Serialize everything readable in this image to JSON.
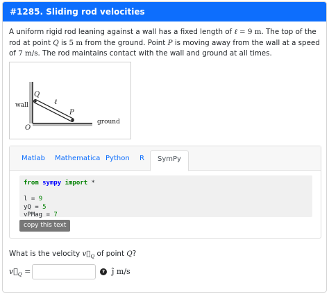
{
  "header": {
    "title": "#1285. Sliding rod velocities"
  },
  "problem": {
    "t1": "A uniform rigid rod leaning against a wall has a fixed length of ",
    "ell": "ℓ",
    "eq1": " = 9 m",
    "t2": ". The top of the rod at point ",
    "Q": "Q",
    "t3": " is ",
    "qval": "5 m",
    "t4": " from the ground. Point ",
    "P": "P",
    "t5": " is moving away from the wall at a speed of ",
    "pval": "7 m/s",
    "t6": ". The rod maintains contact with the wall and ground at all times."
  },
  "figure": {
    "wall_label": "wall",
    "ground_label": "ground",
    "origin_label": "O",
    "q_label": "Q",
    "p_label": "P",
    "ell_label": "ℓ"
  },
  "code": {
    "tabs": [
      "Matlab",
      "Mathematica",
      "Python",
      "R",
      "SymPy"
    ],
    "active_tab": "SymPy",
    "line1_from": "from",
    "line1_mod": "sympy",
    "line1_import": "import",
    "line1_rest": " *",
    "line3_lhs": "l = ",
    "line3_val": "9",
    "line4_lhs": "yQ = ",
    "line4_val": "5",
    "line5_lhs": "vPMag = ",
    "line5_val": "7",
    "copy_label": "copy this text"
  },
  "question": {
    "t1": "What is the velocity ",
    "vq": "v⃗",
    "vq_sub": "Q",
    "t2": " of point ",
    "Q": "Q",
    "t3": "?"
  },
  "answer": {
    "label": "v⃗",
    "label_sub": "Q",
    "eq": " =",
    "value": "",
    "help": "?",
    "unit": "ĵ m/s"
  }
}
